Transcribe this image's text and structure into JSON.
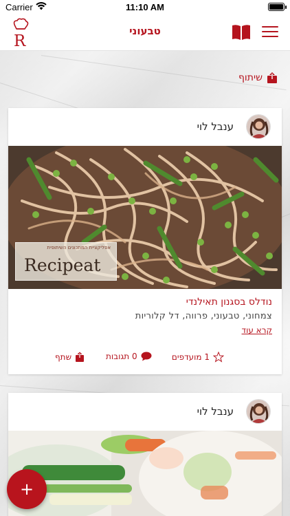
{
  "status_bar": {
    "carrier": "Carrier",
    "time": "11:10 AM",
    "battery_level": 0.9
  },
  "nav": {
    "title": "טבעוני",
    "logo_letter": "R"
  },
  "share_bar": {
    "label": "שיתוף"
  },
  "posts": [
    {
      "author": "ענבל לוי",
      "watermark": {
        "tagline": "אפליקציית המתכונים השיתופית",
        "brand": "Recipeat"
      },
      "title": "נודלס בסגנון תאילנדי",
      "description": "צמחוני, טבעוני, פרווה, דל קלוריות",
      "read_more": "קרא עוד",
      "favorites_label": "1 מועדפים",
      "comments_label": "0 תגובות",
      "share_label": "שתף"
    },
    {
      "author": "ענבל לוי"
    }
  ],
  "fab": {
    "label": "+"
  },
  "colors": {
    "accent": "#b5141e",
    "card": "#ffffff",
    "background": "#e9e9e9"
  }
}
